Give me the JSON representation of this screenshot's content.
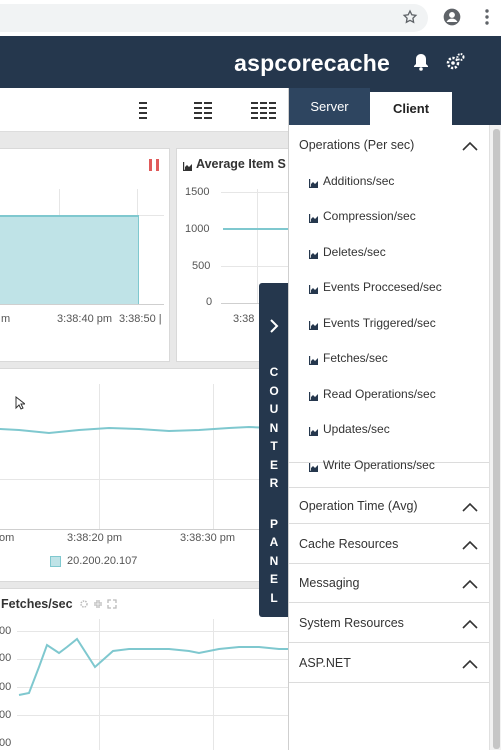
{
  "browser": {
    "icons": [
      "star-icon",
      "account-icon",
      "more-vert-icon"
    ]
  },
  "header": {
    "title": "aspcorecache",
    "icons": [
      "bell-icon",
      "settings-icon"
    ]
  },
  "toolbar": {
    "icons": [
      "layout-one-column-icon",
      "layout-two-column-icon",
      "layout-three-column-icon"
    ]
  },
  "cards": {
    "top_left": {
      "x_ticks": [
        "m",
        "3:38:40 pm",
        "3:38:50 |"
      ],
      "pause_icon": "pause-icon"
    },
    "top_right": {
      "title": "Average Item S",
      "y_ticks": [
        "1500",
        "1000",
        "500",
        "0"
      ],
      "x_ticks": [
        "3:38"
      ]
    },
    "middle": {
      "x_ticks": [
        "om",
        "3:38:20 pm",
        "3:38:30 pm"
      ],
      "legend": "20.200.20.107"
    },
    "bottom": {
      "title": "Fetches/sec",
      "y_ticks": [
        "00",
        "00",
        "00",
        "00",
        "00"
      ]
    }
  },
  "counter_panel": {
    "label": "COUNTER PANEL",
    "letters": [
      "C",
      "O",
      "U",
      "N",
      "T",
      "E",
      "R",
      "",
      "P",
      "A",
      "N",
      "E",
      "L"
    ]
  },
  "panel": {
    "tabs": [
      "Server",
      "Client"
    ],
    "active_tab": "Client",
    "sections": [
      {
        "title": "Operations (Per sec)",
        "items": [
          "Additions/sec",
          "Compression/sec",
          "Deletes/sec",
          "Events Proccesed/sec",
          "Events Triggered/sec",
          "Fetches/sec",
          "Read Operations/sec",
          "Updates/sec",
          "Write Operations/sec"
        ]
      },
      {
        "title": "Operation Time (Avg)"
      },
      {
        "title": "Cache Resources"
      },
      {
        "title": "Messaging"
      },
      {
        "title": "System Resources"
      },
      {
        "title": "ASP.NET"
      }
    ]
  },
  "colors": {
    "header_bg": "#25374d",
    "accent_teal": "#7fc8cf",
    "area_fill": "#bfe3e7",
    "pause_red": "#e05a5a"
  }
}
